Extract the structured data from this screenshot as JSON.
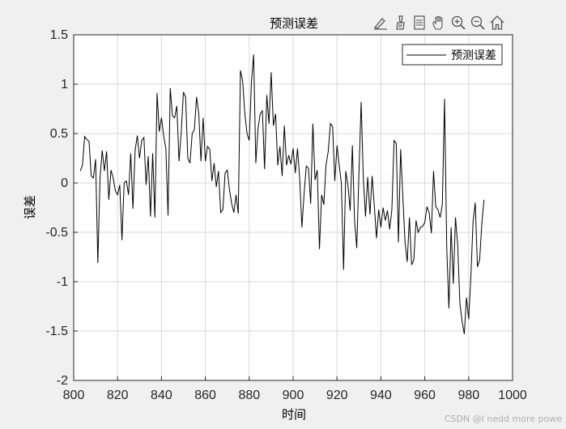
{
  "toolbar": {
    "icons": [
      "annotate-icon",
      "brush-icon",
      "datatip-icon",
      "pan-icon",
      "zoom-in-icon",
      "zoom-out-icon",
      "home-icon"
    ]
  },
  "watermark": "CSDN @I nedd more powe",
  "colors": {
    "line": "#000000",
    "grid": "#d9d9d9",
    "background": "#f0f0f0",
    "axes_bg": "#ffffff"
  },
  "chart_data": {
    "type": "line",
    "title": "预测误差",
    "xlabel": "时间",
    "ylabel": "误差",
    "xlim": [
      800,
      1000
    ],
    "ylim": [
      -2,
      1.5
    ],
    "xticks": [
      800,
      820,
      840,
      860,
      880,
      900,
      920,
      940,
      960,
      980,
      1000
    ],
    "xtick_labels": [
      "800",
      "820",
      "840",
      "860",
      "880",
      "900",
      "920",
      "940",
      "960",
      "980",
      "1000"
    ],
    "yticks": [
      1.5,
      1,
      0.5,
      0,
      -0.5,
      -1,
      -1.5,
      -2
    ],
    "ytick_labels": [
      "1.5",
      "1",
      "0.5",
      "0",
      "-0.5",
      "-1",
      "-1.5",
      "-2"
    ],
    "grid": true,
    "legend_position": "top-right",
    "series": [
      {
        "name": "预测误差",
        "x_start": 803,
        "x_step": 1,
        "values": [
          0.12,
          0.18,
          0.47,
          0.44,
          0.42,
          0.07,
          0.05,
          0.24,
          -0.81,
          0.05,
          0.33,
          0.12,
          0.32,
          -0.17,
          0.13,
          0.05,
          -0.08,
          -0.12,
          -0.02,
          -0.58,
          0.0,
          0.02,
          -0.12,
          0.3,
          -0.26,
          0.33,
          0.48,
          0.25,
          0.43,
          0.46,
          -0.02,
          0.27,
          -0.34,
          0.3,
          -0.35,
          0.91,
          0.52,
          0.66,
          0.48,
          0.35,
          -0.33,
          0.96,
          0.68,
          0.66,
          0.78,
          0.22,
          0.51,
          0.92,
          0.87,
          0.25,
          0.2,
          0.5,
          0.54,
          0.87,
          0.7,
          0.22,
          0.66,
          0.22,
          0.37,
          0.34,
          0.02,
          0.2,
          -0.04,
          0.12,
          -0.3,
          -0.27,
          0.1,
          0.13,
          -0.07,
          -0.21,
          -0.3,
          -0.12,
          -0.31,
          1.14,
          1.03,
          0.7,
          0.5,
          0.43,
          1.02,
          1.3,
          0.2,
          0.55,
          0.7,
          0.73,
          0.14,
          0.89,
          0.6,
          1.12,
          0.58,
          0.7,
          0.18,
          0.37,
          0.07,
          0.58,
          0.18,
          0.28,
          0.19,
          0.35,
          0.1,
          0.35,
          0.04,
          -0.45,
          -0.11,
          0.17,
          0.15,
          -0.21,
          0.6,
          0.03,
          0.13,
          -0.67,
          -0.12,
          -0.22,
          0.18,
          0.32,
          0.6,
          0.57,
          0.02,
          0.38,
          0.18,
          -0.01,
          -0.88,
          0.12,
          -0.03,
          -0.28,
          0.38,
          -0.38,
          -0.66,
          0.1,
          0.82,
          0.04,
          -0.34,
          0.06,
          -0.32,
          0.07,
          -0.23,
          -0.56,
          -0.27,
          -0.45,
          -0.25,
          -0.38,
          -0.28,
          -0.47,
          -0.27,
          0.43,
          0.4,
          -0.6,
          0.34,
          -0.14,
          -0.6,
          -0.8,
          -0.35,
          -0.83,
          -0.78,
          -0.38,
          -0.5,
          -0.45,
          -0.44,
          -0.4,
          -0.24,
          -0.3,
          -0.51,
          0.12,
          -0.24,
          -0.27,
          -0.35,
          -0.22,
          0.85,
          -0.65,
          -1.27,
          -0.45,
          -1.02,
          -0.35,
          -0.63,
          -1.22,
          -1.4,
          -1.53,
          -1.16,
          -1.38,
          -0.95,
          -0.39,
          -0.2,
          -0.85,
          -0.78,
          -0.41,
          -0.17
        ]
      }
    ]
  }
}
